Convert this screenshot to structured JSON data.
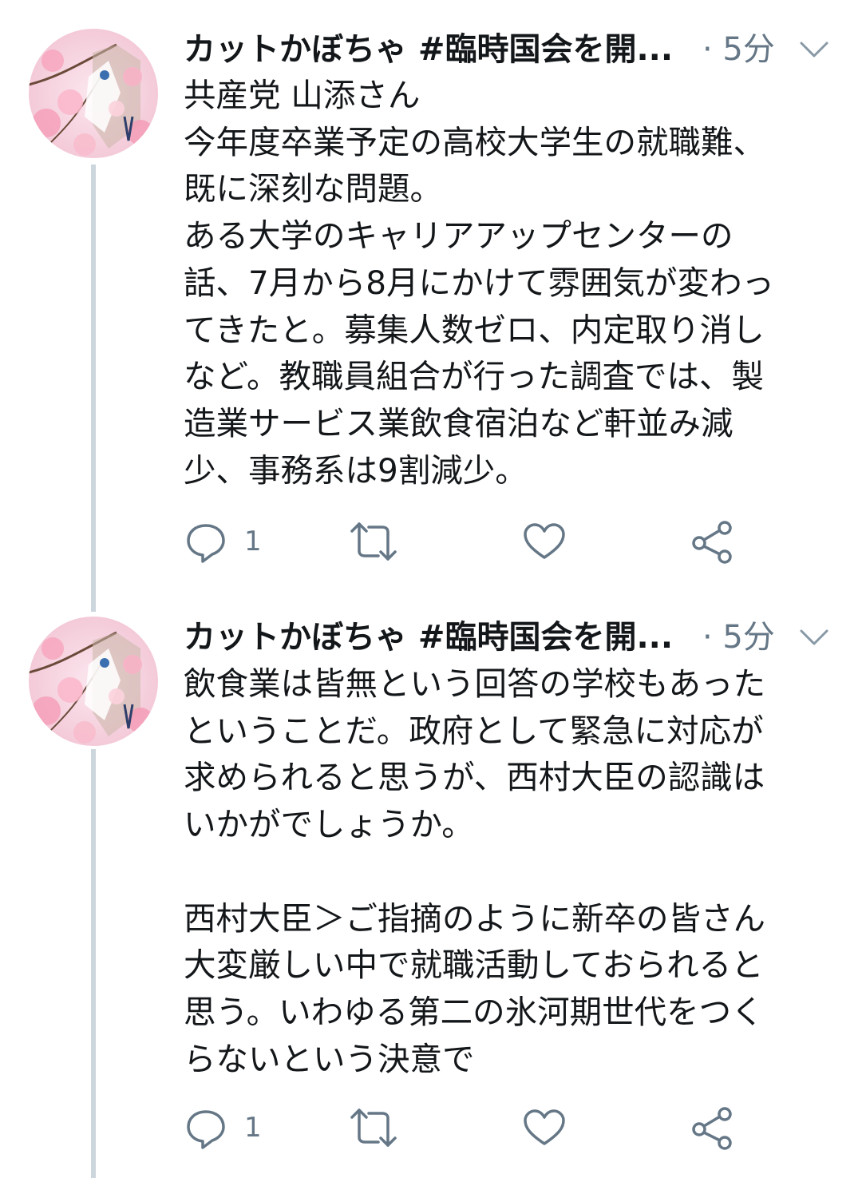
{
  "colors": {
    "text": "#14171a",
    "secondary": "#657786",
    "thread_line": "#ccd6dd",
    "icon": "#657786"
  },
  "tweets": [
    {
      "author_name": "カットかぼちゃ #臨時国会を開...",
      "time": "· 5分",
      "avatar_icon": "cherry-blossom-avatar",
      "lines": [
        "共産党 山添さん",
        "今年度卒業予定の高校大学生の就職難、",
        "既に深刻な問題。",
        "ある大学のキャリアアップセンターの",
        "話、7月から8月にかけて雰囲気が変わっ",
        "てきたと。募集人数ゼロ、内定取り消し",
        "など。教職員組合が行った調査では、製",
        "造業サービス業飲食宿泊など軒並み減",
        "少、事務系は9割減少。"
      ],
      "reply_count": "1",
      "icons": [
        "reply-icon",
        "retweet-icon",
        "like-icon",
        "share-icon"
      ]
    },
    {
      "author_name": "カットかぼちゃ #臨時国会を開...",
      "time": "· 5分",
      "avatar_icon": "cherry-blossom-avatar",
      "lines": [
        "飲食業は皆無という回答の学校もあった",
        "ということだ。政府として緊急に対応が",
        "求められると思うが、西村大臣の認識は",
        "いかがでしょうか。",
        "",
        "西村大臣＞ご指摘のように新卒の皆さん",
        "大変厳しい中で就職活動しておられると",
        "思う。いわゆる第二の氷河期世代をつく",
        "らないという決意で"
      ],
      "reply_count": "1",
      "icons": [
        "reply-icon",
        "retweet-icon",
        "like-icon",
        "share-icon"
      ]
    }
  ]
}
